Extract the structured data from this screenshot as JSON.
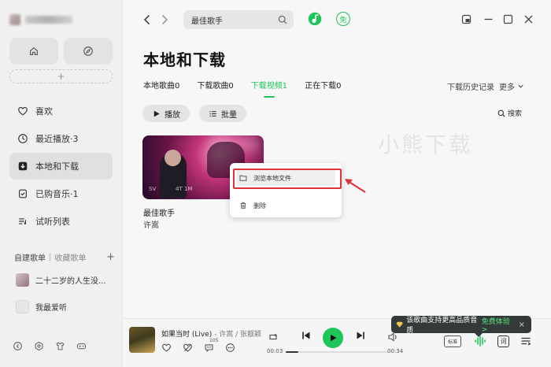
{
  "sidebar": {
    "nav": [
      {
        "label": "喜欢",
        "icon": "heart-icon"
      },
      {
        "label": "最近播放·3",
        "icon": "clock-icon"
      },
      {
        "label": "本地和下载",
        "icon": "download-icon"
      },
      {
        "label": "已购音乐·1",
        "icon": "purchase-icon"
      },
      {
        "label": "试听列表",
        "icon": "list-icon"
      }
    ],
    "active_index": 2,
    "playlist_tabs": {
      "created": "自建歌单",
      "separator": "|",
      "collected": "收藏歌单",
      "add": "+"
    },
    "playlists": [
      {
        "label": "二十二岁的人生没..."
      },
      {
        "label": "我最爱听"
      }
    ],
    "add_label": "+"
  },
  "topbar": {
    "search_value": "最佳歌手",
    "free_label": "免"
  },
  "main": {
    "title": "本地和下载",
    "tabs": [
      {
        "label": "本地歌曲0"
      },
      {
        "label": "下载歌曲0"
      },
      {
        "label": "下载视频1"
      },
      {
        "label": "正在下载0"
      }
    ],
    "active_tab": 2,
    "history_label": "下载历史记录",
    "more_label": "更多",
    "play_label": "播放",
    "batch_label": "批量",
    "search_label": "搜索",
    "watermark": "小熊下载",
    "video": {
      "title": "最佳歌手",
      "artist": "许嵩",
      "overlay_left": "SV",
      "overlay_right": "4T 1M"
    }
  },
  "context_menu": {
    "items": [
      {
        "label": "浏览本地文件",
        "icon": "folder-icon"
      },
      {
        "label": "删除",
        "icon": "trash-icon"
      }
    ]
  },
  "player": {
    "title": "如果当时 (Live)",
    "artist": " - 许嵩 / 张靓颖",
    "comments": "105",
    "time_current": "00:03",
    "time_total": "00:34",
    "quality": "标准",
    "lyric": "词",
    "progress": 0.12
  },
  "tooltip": {
    "text": "该歌曲支持更高品质音质",
    "promo": "免费体验 >",
    "close": "×"
  },
  "colors": {
    "accent": "#1ec65a",
    "highlight": "#e0343a"
  }
}
